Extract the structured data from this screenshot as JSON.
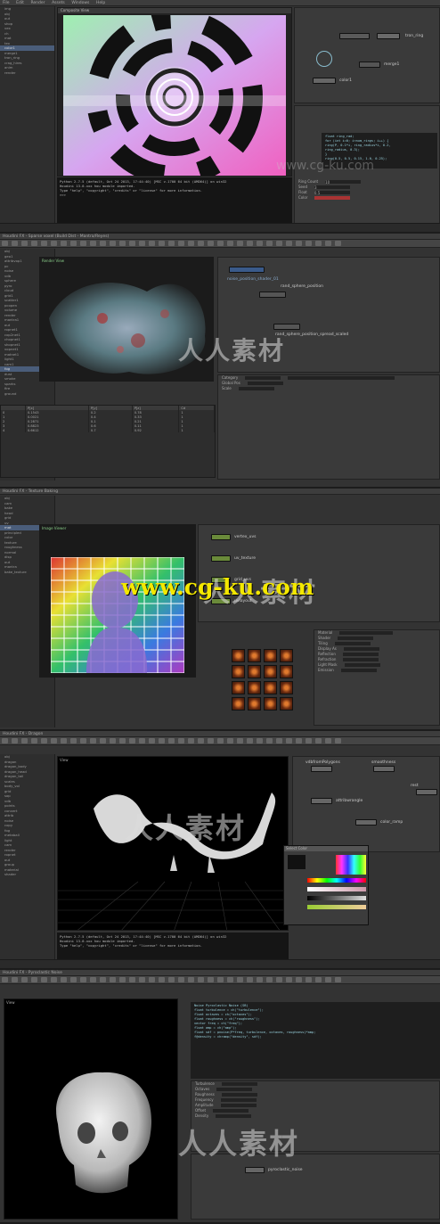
{
  "panel1": {
    "menu": [
      "File",
      "Edit",
      "Render",
      "Assets",
      "Windows",
      "Help"
    ],
    "viewport_title": "Composite View",
    "tree": [
      "img",
      "obj",
      "out",
      "shop",
      "vex",
      "ch",
      "mat",
      "tex",
      "color1",
      "merge1",
      "tron_ring",
      "crag_hires",
      "anim",
      "render"
    ],
    "nodes": {
      "tron": "tron_ring",
      "merge": "merge1",
      "color": "color1"
    },
    "python": [
      "Python 2.7.5 (default, Oct 24 2013, 17:44:40) [MSC v.1700 64 bit (AMD64)] on win32",
      "Houdini 13.0.xxx hou module imported.",
      "Type \"help\", \"copyright\", \"credits\" or \"license\" for more information.",
      ">>>"
    ],
    "code": [
      "float ring_rad;",
      "for (int i=0; i<num_rings; i++) {",
      "  ring(P, 0.1*i, ring_radius*i, 0.2,",
      "   ring_radius, 0.3);",
      "}",
      "ring(0.5, 0.5, 0.15, 1.0, 0.25);"
    ],
    "params": [
      "Ring Count",
      "Seed",
      "Float",
      "Color"
    ],
    "fields": [
      "10",
      "3",
      "0.5"
    ],
    "watermark": "www.cg-ku.com"
  },
  "panel2": {
    "header": "Houdini FX - Sparse voxel (Build Dist - Mantra/Reyes)",
    "menu": [
      "File",
      "Edit",
      "Render",
      "Assets",
      "Windows",
      "Help"
    ],
    "viewport_label": "Render View",
    "tree": [
      "obj",
      "geo1",
      "attribvop1",
      "pc",
      "noise",
      "vdb",
      "sphere",
      "pyro",
      "cloud",
      "grid1",
      "scatter1",
      "pcopen",
      "volume",
      "render",
      "mantra1",
      "out",
      "ropnet1",
      "cop2net1",
      "chopnet1",
      "shopnet1",
      "vopnet1",
      "matnet1",
      "light1",
      "cam1",
      "fog",
      "dust",
      "smoke",
      "sparks",
      "fire",
      "ground"
    ],
    "nodes": [
      "noise_position_shader_01",
      "rand_sphere_position",
      "rand_sphere_position_spread_scaled"
    ],
    "params": [
      "Category",
      "Global Pos",
      "Scale"
    ],
    "table_headers": [
      "",
      "P[x]",
      "P[y]",
      "P[z]",
      "Cd"
    ],
    "table_rows": [
      [
        "0",
        "0.1543",
        "0.2",
        "0.78",
        "1"
      ],
      [
        "1",
        "0.0021",
        "0.4",
        "0.33",
        "1"
      ],
      [
        "2",
        "0.2871",
        "0.1",
        "0.21",
        "1"
      ],
      [
        "3",
        "0.8823",
        "0.6",
        "0.11",
        "1"
      ],
      [
        "4",
        "0.6612",
        "0.7",
        "0.92",
        "1"
      ]
    ],
    "watermark": "人人素材"
  },
  "panel3": {
    "header": "Houdini FX - Texture Baking",
    "viewport_label": "Image Viewer",
    "tree": [
      "obj",
      "cam",
      "bake",
      "head",
      "grid",
      "uv",
      "mat",
      "principled",
      "color",
      "texture",
      "roughness",
      "normal",
      "disp",
      "out",
      "mantra",
      "bake_texture"
    ],
    "nodes": [
      "vertex_uvs",
      "uv_texture",
      "grid_uvs",
      "uvlayout"
    ],
    "params": [
      "Material",
      "Shader",
      "Tiling",
      "Display As",
      "Reflection",
      "Refraction",
      "Light Mask",
      "Emission"
    ],
    "watermark": "www.cg-ku.com",
    "watermark_cn": "人人素材"
  },
  "panel4": {
    "header": "Houdini FX - Dragon",
    "viewport_label": "View",
    "tree": [
      "obj",
      "dragon",
      "dragon_body",
      "dragon_head",
      "dragon_tail",
      "scales",
      "body_vol",
      "grid",
      "sop",
      "vdb",
      "points",
      "convert",
      "attrib",
      "noise",
      "copy",
      "fog",
      "metaball",
      "light",
      "cam",
      "render",
      "ropnet",
      "out",
      "group",
      "material",
      "shader"
    ],
    "nodes": [
      "vdbfromPolygons",
      "smoothness",
      "attribwrangle",
      "rest",
      "color_ramp"
    ],
    "python": [
      "Python 2.7.5 (default, Oct 24 2013, 17:44:40) [MSC v.1700 64 bit (AMD64)] on win32",
      "Houdini 13.0.xxx hou module imported.",
      "Type \"help\", \"copyright\", \"credits\" or \"license\" for more information."
    ],
    "color_dialog": "Select Color",
    "watermark": "人人素材"
  },
  "panel5": {
    "header": "Houdini FX - Pyroclastic Noise",
    "viewport_label": "View",
    "tree": [
      "obj",
      "skull",
      "skull_geo",
      "vdb",
      "noise",
      "pyro",
      "volume",
      "render"
    ],
    "code": [
      "Noise Pyroclastic Noise (SB)",
      "float  turbulence = ch(\"turbulence\");",
      "float  octaves = ch(\"octaves\");",
      "float  roughness = ch(\"roughness\");",
      "vector  freq = ch(\"freq\");",
      "float  amp = ch(\"amp\");",
      "float  sdf = pnoise(P*freq, turbulence, octaves, roughness)*amp;",
      "f@density = chramp(\"density\", sdf);"
    ],
    "params": [
      "Turbulence",
      "Octaves",
      "Roughness",
      "Frequency",
      "Amplitude",
      "Offset",
      "Density"
    ],
    "node": "pyroclastic_noise",
    "watermark": "人人素材"
  }
}
